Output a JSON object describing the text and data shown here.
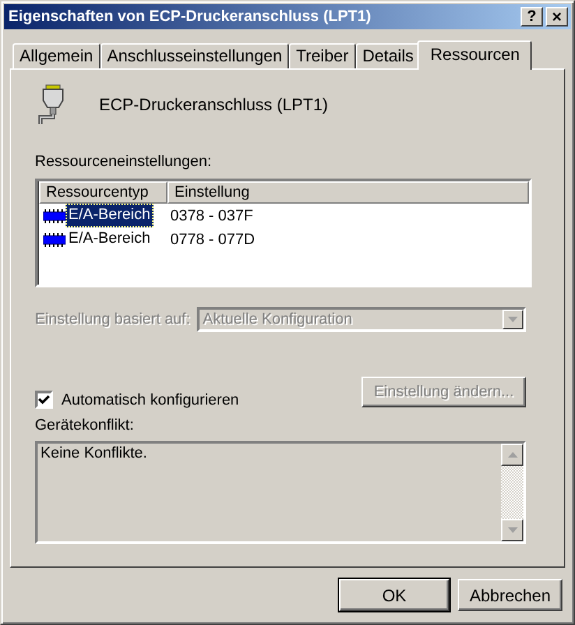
{
  "window": {
    "title": "Eigenschaften von ECP-Druckeranschluss (LPT1)",
    "title_buttons": [
      {
        "kind": "help",
        "label": "?"
      },
      {
        "kind": "close",
        "label": "×"
      }
    ]
  },
  "tabs": [
    {
      "label": "Allgemein",
      "selected": false
    },
    {
      "label": "Anschlusseinstellungen",
      "selected": false
    },
    {
      "label": "Treiber",
      "selected": false
    },
    {
      "label": "Details",
      "selected": false
    },
    {
      "label": "Ressourcen",
      "selected": true
    }
  ],
  "device": {
    "name": "ECP-Druckeranschluss (LPT1)"
  },
  "resources": {
    "label": "Ressourceneinstellungen:",
    "columns": [
      "Ressourcentyp",
      "Einstellung"
    ],
    "rows": [
      {
        "type": "E/A-Bereich",
        "setting": "0378 - 037F",
        "selected": true
      },
      {
        "type": "E/A-Bereich",
        "setting": "0778 - 077D",
        "selected": false
      }
    ]
  },
  "based_on": {
    "label": "Einstellung basiert auf:",
    "value": "Aktuelle Konfiguration",
    "disabled": true
  },
  "auto_config": {
    "label": "Automatisch konfigurieren",
    "checked": true
  },
  "change_button": {
    "label": "Einstellung ändern...",
    "disabled": true
  },
  "conflict": {
    "label": "Gerätekonflikt:",
    "text": "Keine Konflikte."
  },
  "buttons": [
    {
      "label": "OK",
      "default": true
    },
    {
      "label": "Abbrechen",
      "default": false
    }
  ]
}
